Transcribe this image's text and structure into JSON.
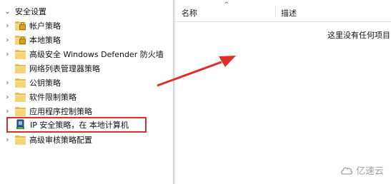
{
  "tree": {
    "root": "安全设置",
    "items": [
      {
        "label": "帐户策略",
        "icon": "lock-folder-icon",
        "expander": true
      },
      {
        "label": "本地策略",
        "icon": "lock-folder-icon",
        "expander": true
      },
      {
        "label": "高级安全 Windows Defender 防火墙",
        "icon": "folder-icon",
        "expander": true
      },
      {
        "label": "网络列表管理器策略",
        "icon": "folder-icon",
        "expander": false
      },
      {
        "label": "公钥策略",
        "icon": "folder-icon",
        "expander": true
      },
      {
        "label": "软件限制策略",
        "icon": "folder-icon",
        "expander": true
      },
      {
        "label": "应用程序控制策略",
        "icon": "folder-icon",
        "expander": true
      },
      {
        "label": "IP 安全策略，在 本地计算机",
        "icon": "ip-security-policy-icon",
        "expander": false,
        "highlighted": true
      },
      {
        "label": "高级审核策略配置",
        "icon": "folder-icon",
        "expander": true
      }
    ]
  },
  "list": {
    "columns": [
      "名称",
      "描述"
    ],
    "empty_message": "这里没有任何项目"
  },
  "annotation": {
    "color": "#d9302b"
  },
  "watermark": {
    "text": "亿速云"
  }
}
